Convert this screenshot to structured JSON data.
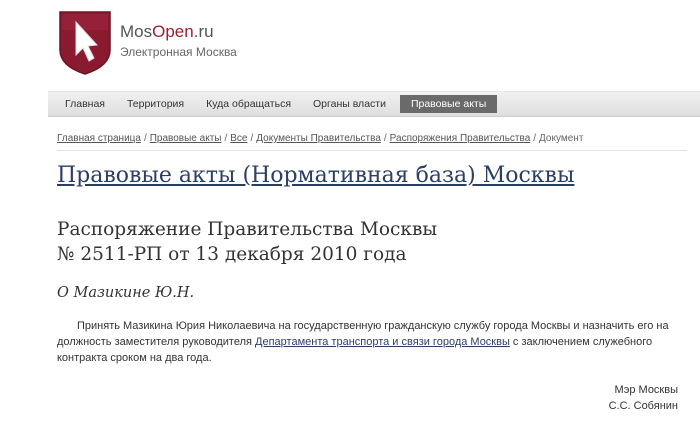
{
  "brand": {
    "name_part1": "Mos",
    "name_part2": "Open",
    "name_part3": ".ru",
    "tagline": "Электронная Москва",
    "accent_color": "#a01e35"
  },
  "nav": {
    "items": [
      {
        "label": "Главная"
      },
      {
        "label": "Территория"
      },
      {
        "label": "Куда обращаться"
      },
      {
        "label": "Органы власти"
      },
      {
        "label": "Правовые акты",
        "active": true
      }
    ]
  },
  "breadcrumb": {
    "items": [
      {
        "label": "Главная страница",
        "link": true
      },
      {
        "label": "Правовые акты",
        "link": true
      },
      {
        "label": "Все",
        "link": true
      },
      {
        "label": "Документы Правительства",
        "link": true
      },
      {
        "label": "Распоряжения Правительства",
        "link": true
      },
      {
        "label": "Документ",
        "link": false
      }
    ],
    "separator": "/"
  },
  "main": {
    "title": "Правовые акты (Нормативная база) Москвы",
    "heading_line1": "Распоряжение Правительства Москвы",
    "heading_line2": "№ 2511-РП от 13 декабря 2010 года",
    "subject": "О Мазикине Ю.Н.",
    "body_part1": "Принять Мазикина Юрия Николаевича на государственную гражданскую службу города Москвы и назначить его на должность заместителя руководителя ",
    "body_link": "Департамента транспорта и связи города Москвы",
    "body_part2": " с заключением служебного контракта сроком на два года.",
    "signature_title": "Мэр Москвы",
    "signature_name": "С.С. Собянин"
  }
}
